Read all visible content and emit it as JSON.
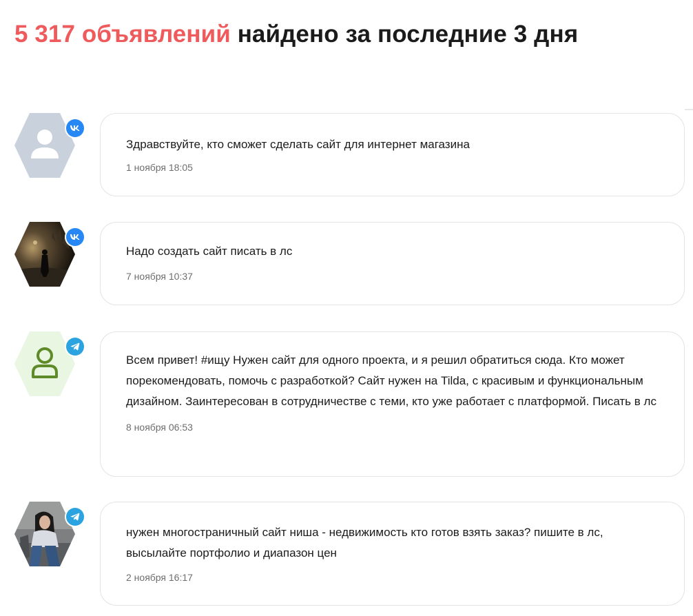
{
  "header": {
    "count": "5 317 объявлений",
    "rest": "найдено за последние 3 дня"
  },
  "colors": {
    "accent": "#ef5b5d",
    "vk": "#2787f5",
    "telegram": "#2aa3e0",
    "card_border": "#e3e3e3",
    "date_text": "#6e6e6e"
  },
  "posts": [
    {
      "source": "vk",
      "avatar": "default-user-avatar",
      "text": "Здравствуйте, кто сможет сделать сайт для интернет магазина",
      "date": "1 ноября 18:05"
    },
    {
      "source": "vk",
      "avatar": "night-photo-avatar",
      "text": "Надо создать сайт писать в лс",
      "date": "7 ноября 10:37"
    },
    {
      "source": "telegram",
      "avatar": "outline-user-avatar",
      "text": "Всем привет! #ищу Нужен сайт для одного проекта, и я решил обратиться сюда. Кто может порекомендовать, помочь с разработкой? Сайт нужен на Tilda, с красивым и функциональным дизайном. Заинтересован в сотрудничестве с теми, кто уже работает с платформой. Писать в лс",
      "date": "8 ноября 06:53"
    },
    {
      "source": "telegram",
      "avatar": "girl-photo-avatar",
      "text": "нужен многостраничный сайт ниша - недвижимость кто готов взять заказ? пишите в лс, высылайте портфолио и диапазон цен",
      "date": "2 ноября 16:17"
    }
  ]
}
